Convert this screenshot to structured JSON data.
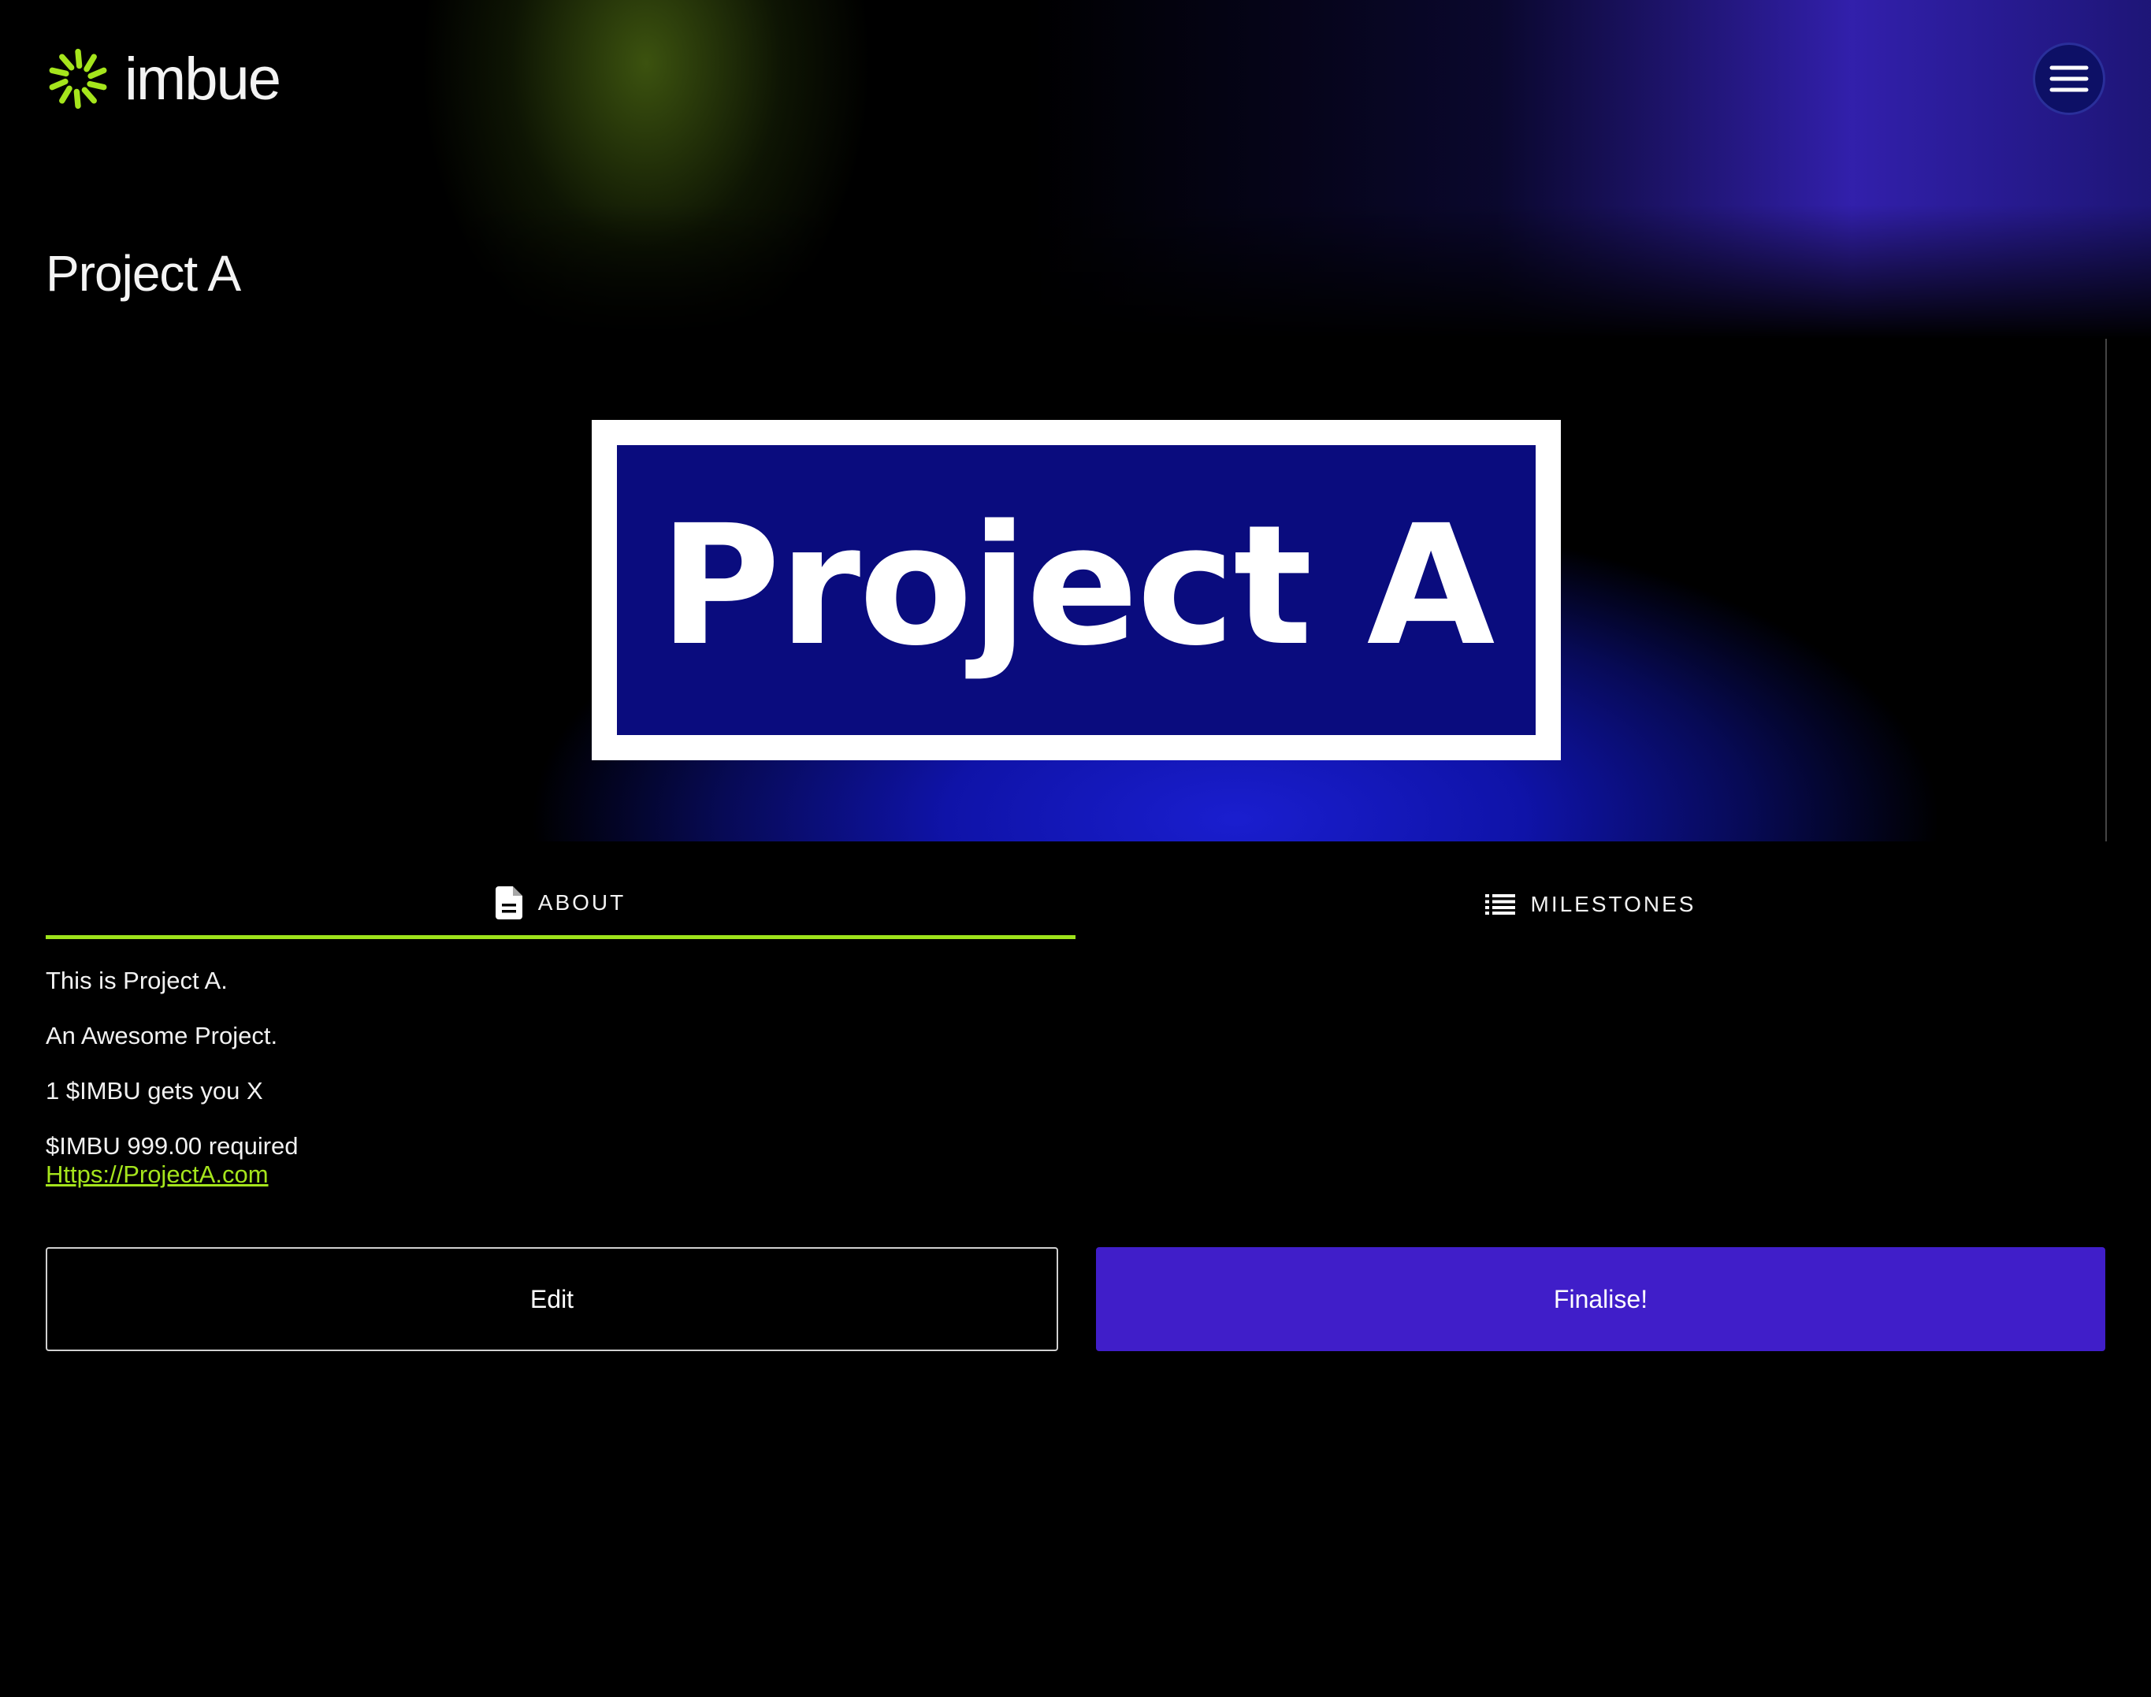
{
  "header": {
    "brand_name": "imbue",
    "logo_icon": "imbue-sunburst-logo-icon",
    "menu_icon": "hamburger-menu-icon"
  },
  "page": {
    "title": "Project A"
  },
  "banner": {
    "text": "Project A"
  },
  "tabs": [
    {
      "label": "ABOUT",
      "icon": "document-icon",
      "active": true
    },
    {
      "label": "MILESTONES",
      "icon": "list-icon",
      "active": false
    }
  ],
  "about": {
    "line1": "This is Project A.",
    "line2": "An Awesome Project.",
    "line3": "1 $IMBU gets you X",
    "funding": "$IMBU 999.00 required",
    "website": "Https://ProjectA.com"
  },
  "actions": {
    "edit_label": "Edit",
    "finalise_label": "Finalise!"
  },
  "colors": {
    "accent_green": "#a5e51c",
    "primary_purple": "#401ec9",
    "banner_blue": "#0a0c7e",
    "background": "#000000"
  }
}
